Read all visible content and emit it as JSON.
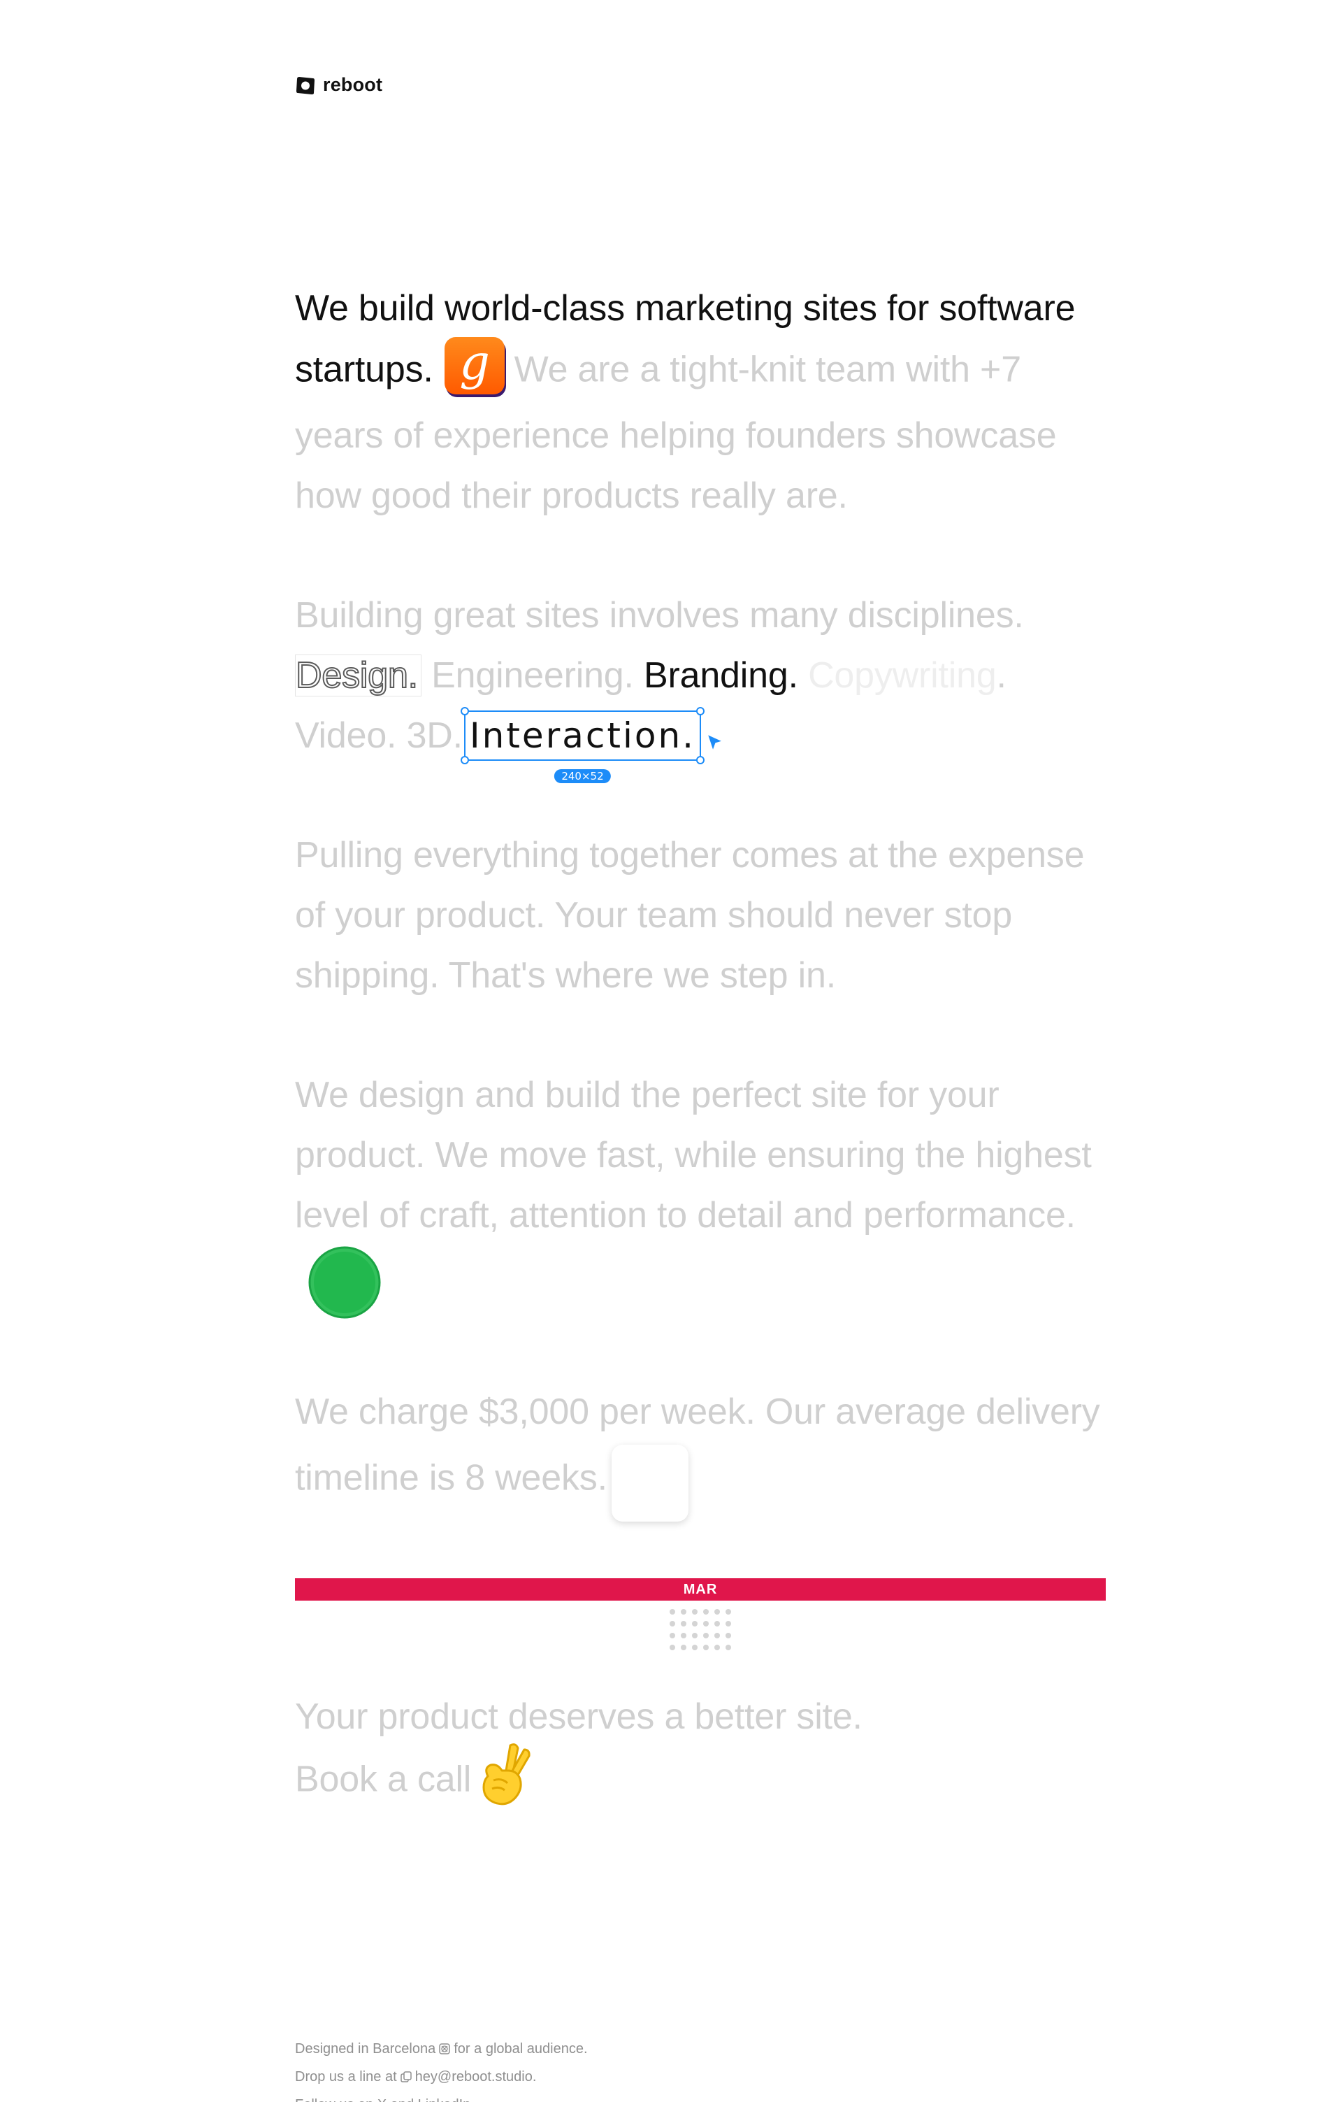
{
  "logo": {
    "text": "reboot"
  },
  "paragraphs": {
    "p1": {
      "dark": "We build world-class marketing sites for software startups.",
      "muted": "We are a tight-knit team with +7 years of experience helping founders showcase how good their products really are."
    },
    "p2": {
      "intro": "Building great sites involves many disciplines.",
      "design": "Design.",
      "engineering": "Engineering.",
      "branding": "Branding.",
      "copywriting": "Copywriting",
      "period": ".",
      "video": "Video.",
      "threed": "3D.",
      "interaction": "Interaction.",
      "size_badge": "240×52"
    },
    "p3": "Pulling everything together comes at the expense of your product. Your team should never stop shipping. That's where we step in.",
    "p4": "We design and build the perfect site for your product. We move fast, while ensuring the highest level of craft, attention to detail and performance.",
    "p5": "We charge $3,000 per week. Our average delivery timeline is 8 weeks.",
    "calendar_month": "MAR",
    "p6": {
      "line1": "Your product deserves a better site.",
      "cta": "Book a call"
    }
  },
  "icons": {
    "app_icon": "g-app-icon",
    "cursor": "cursor-arrow-icon",
    "green_dot": "green-circle-icon",
    "calendar": "calendar-icon",
    "peace": "peace-hand-icon"
  },
  "colors": {
    "text_dark": "#111111",
    "text_muted": "#cfcfcf",
    "accent_blue": "#1d8cf8",
    "orange": "#ff6a00",
    "green": "#22c55e",
    "calendar_red": "#e0164b"
  },
  "footer": {
    "line1_a": "Designed in Barcelona",
    "line1_b": "for a global audience.",
    "line2_a": "Drop us a line at",
    "email": "hey@reboot.studio.",
    "line3": "Follow us on X and LinkedIn"
  }
}
